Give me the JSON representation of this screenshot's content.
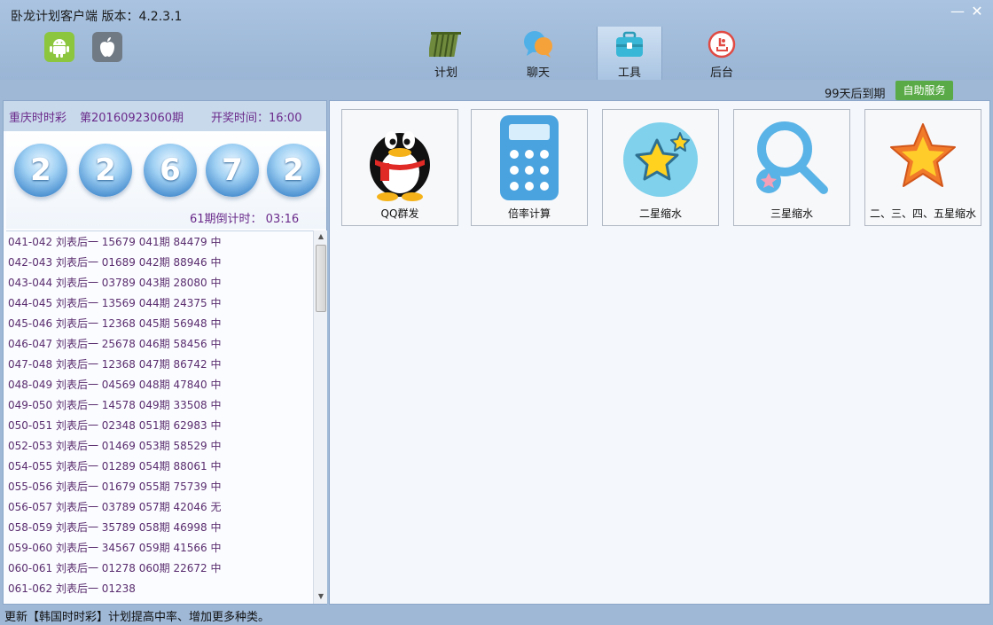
{
  "window": {
    "title": "卧龙计划客户端 版本：4.2.3.1",
    "minimize": "—",
    "close": "✕"
  },
  "os_icons": [
    "android-icon",
    "apple-icon"
  ],
  "nav": {
    "tabs": [
      {
        "label": "计划",
        "icon": "plan-scroll-icon"
      },
      {
        "label": "聊天",
        "icon": "chat-bubble-icon"
      },
      {
        "label": "工具",
        "icon": "toolbox-icon",
        "active": true
      },
      {
        "label": "后台",
        "icon": "backend-icon"
      }
    ]
  },
  "account": {
    "expire_text": "99天后到期",
    "service_button": "自助服务"
  },
  "lottery": {
    "name": "重庆时时彩",
    "issue": "第20160923060期",
    "draw_time": "开奖时间：16:00",
    "balls": [
      "2",
      "2",
      "6",
      "7",
      "2"
    ],
    "countdown": "61期倒计时： 03:16"
  },
  "history": [
    "041-042 刘表后一  15679  041期 84479 中",
    "042-043 刘表后一  01689  042期 88946 中",
    "043-044 刘表后一  03789  043期 28080 中",
    "044-045 刘表后一  13569  044期 24375 中",
    "045-046 刘表后一  12368  045期 56948 中",
    "046-047 刘表后一  25678  046期 58456 中",
    "047-048 刘表后一  12368  047期 86742 中",
    "048-049 刘表后一  04569  048期 47840 中",
    "049-050 刘表后一  14578  049期 33508 中",
    "050-051 刘表后一  02348  051期 62983 中",
    "052-053 刘表后一  01469  053期 58529 中",
    "054-055 刘表后一  01289  054期 88061 中",
    "055-056 刘表后一  01679  055期 75739 中",
    "056-057 刘表后一  03789  057期 42046 无",
    "058-059 刘表后一  35789  058期 46998 中",
    "059-060 刘表后一  34567  059期 41566 中",
    "060-061 刘表后一  01278  060期 22672 中",
    "061-062 刘表后一  01238"
  ],
  "tools": [
    {
      "label": "QQ群发",
      "icon": "qq-penguin-icon"
    },
    {
      "label": "倍率计算",
      "icon": "calculator-icon"
    },
    {
      "label": "二星缩水",
      "icon": "star-circle-icon"
    },
    {
      "label": "三星缩水",
      "icon": "magnifier-star-icon"
    },
    {
      "label": "二、三、四、五星缩水",
      "icon": "orange-star-icon"
    }
  ],
  "status": "更新【韩国时时彩】计划提高中率、增加更多种类。",
  "colors": {
    "accent_purple": "#6a2a8a",
    "service_green": "#5aab47",
    "chrome_blue": "#9fb8d6"
  }
}
